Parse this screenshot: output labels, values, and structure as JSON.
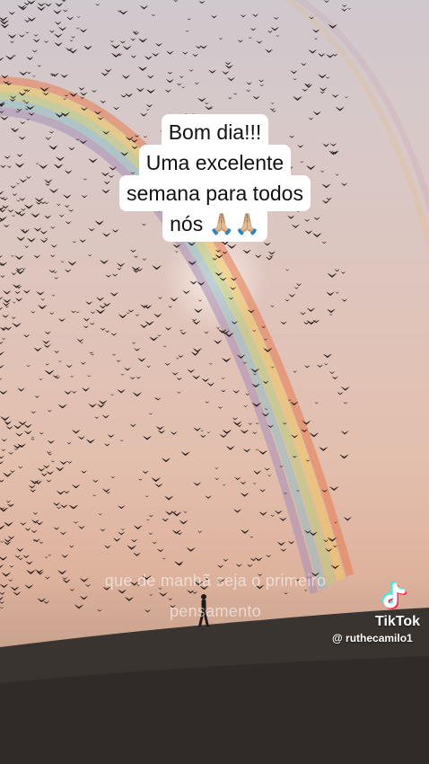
{
  "caption": {
    "lines": [
      "Bom dia!!!",
      "Uma excelente",
      "semana para todos",
      "nós 🙏🏼🙏🏼"
    ]
  },
  "lyrics": {
    "line1": "que de manhã seja o primeiro",
    "line2": "pensamento"
  },
  "watermark": {
    "brand": "TikTok",
    "username": "@ ruthecamilo1",
    "icon": "tiktok-note-icon"
  },
  "colors": {
    "caption_bg": "#ffffff",
    "caption_text": "#111111",
    "tiktok_cyan": "#25f4ee",
    "tiktok_red": "#fe2c55"
  }
}
